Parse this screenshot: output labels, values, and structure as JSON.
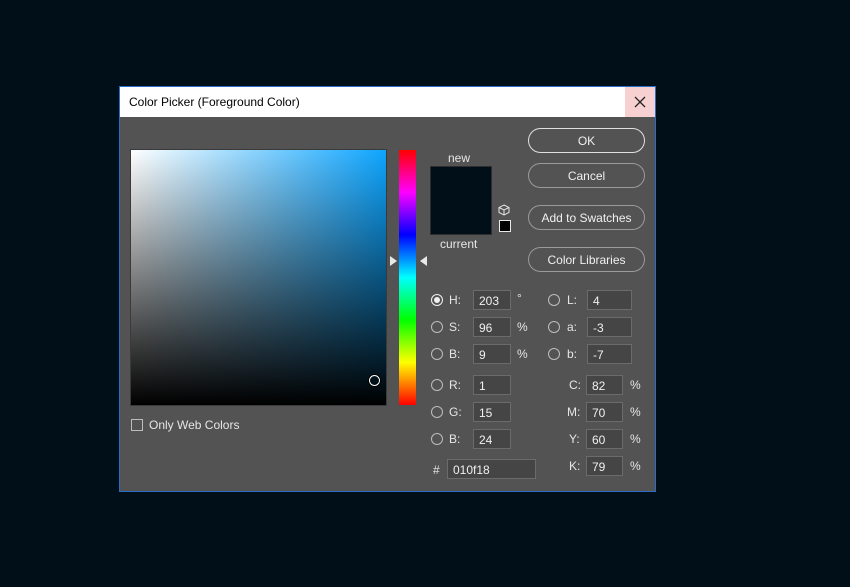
{
  "dialog": {
    "title": "Color Picker (Foreground Color)",
    "close_icon": "close-icon"
  },
  "preview": {
    "new_label": "new",
    "current_label": "current",
    "new_color": "#010f18",
    "current_color": "#010f18"
  },
  "buttons": {
    "ok": "OK",
    "cancel": "Cancel",
    "add_to_swatches": "Add to Swatches",
    "color_libraries": "Color Libraries"
  },
  "hsb": {
    "h_label": "H:",
    "h_value": "203",
    "h_unit": "°",
    "s_label": "S:",
    "s_value": "96",
    "s_unit": "%",
    "b_label": "B:",
    "b_value": "9",
    "b_unit": "%"
  },
  "lab": {
    "l_label": "L:",
    "l_value": "4",
    "a_label": "a:",
    "a_value": "-3",
    "b_label": "b:",
    "b_value": "-7"
  },
  "rgb": {
    "r_label": "R:",
    "r_value": "1",
    "g_label": "G:",
    "g_value": "15",
    "b_label": "B:",
    "b_value": "24"
  },
  "cmyk": {
    "c_label": "C:",
    "c_value": "82",
    "c_unit": "%",
    "m_label": "M:",
    "m_value": "70",
    "m_unit": "%",
    "y_label": "Y:",
    "y_value": "60",
    "y_unit": "%",
    "k_label": "K:",
    "k_value": "79",
    "k_unit": "%"
  },
  "hex": {
    "label": "#",
    "value": "010f18"
  },
  "options": {
    "only_web_colors": "Only Web Colors"
  },
  "colors": {
    "background": "#010f18",
    "dialog_bg": "#535353",
    "accent_border": "#2b6cc4",
    "close_hover": "#f7d0d2"
  }
}
